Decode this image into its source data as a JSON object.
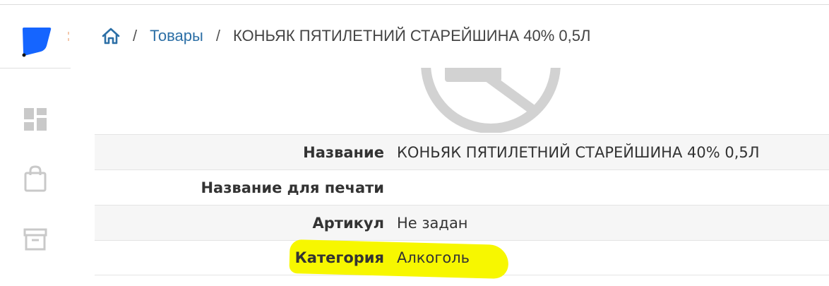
{
  "sidebar": {
    "icons": [
      "logo-icon",
      "dashboard-icon",
      "shopping-bag-icon",
      "archive-icon"
    ],
    "brand_color": "#1565ff"
  },
  "breadcrumb": {
    "home_icon": "home-icon",
    "separator": "/",
    "link": "Товары",
    "current": "КОНЬЯК ПЯТИЛЕТНИЙ СТАРЕЙШИНА 40% 0,5Л"
  },
  "product": {
    "image": "no-image-icon",
    "rows": [
      {
        "label": "Название",
        "value": "КОНЬЯК ПЯТИЛЕТНИЙ СТАРЕЙШИНА 40% 0,5Л"
      },
      {
        "label": "Название для печати",
        "value": ""
      },
      {
        "label": "Артикул",
        "value": "Не задан"
      },
      {
        "label": "Категория",
        "value": "Алкоголь"
      }
    ]
  },
  "highlight_color": "#f7f700"
}
